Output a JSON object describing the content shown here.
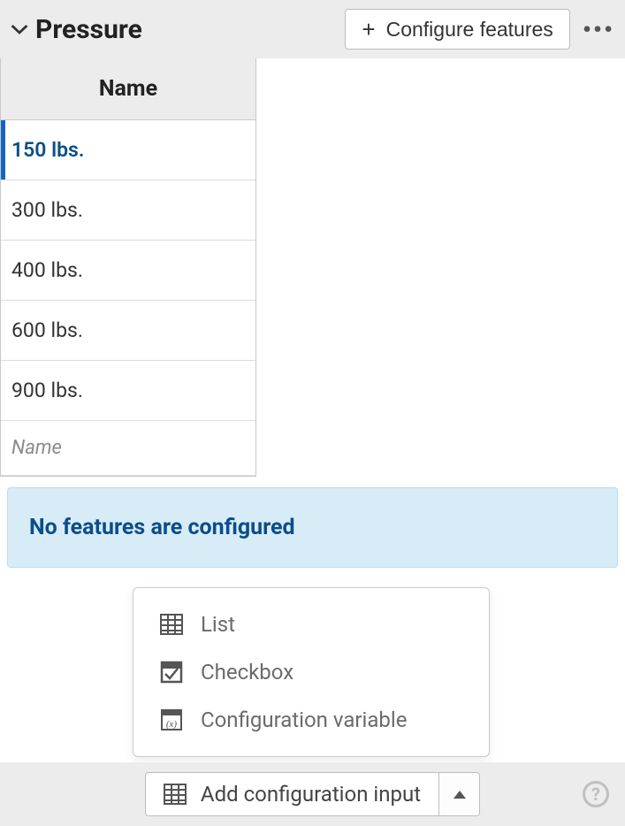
{
  "header": {
    "title": "Pressure",
    "configure_label": "Configure features"
  },
  "table": {
    "column_header": "Name",
    "rows": [
      {
        "label": "150 lbs.",
        "selected": true
      },
      {
        "label": "300 lbs.",
        "selected": false
      },
      {
        "label": "400 lbs.",
        "selected": false
      },
      {
        "label": "600 lbs.",
        "selected": false
      },
      {
        "label": "900 lbs.",
        "selected": false
      }
    ],
    "new_row_placeholder": "Name"
  },
  "banner": {
    "message": "No features are configured"
  },
  "popup": {
    "items": [
      {
        "label": "List",
        "icon": "table-icon"
      },
      {
        "label": "Checkbox",
        "icon": "checkbox-icon"
      },
      {
        "label": "Configuration variable",
        "icon": "variable-icon"
      }
    ]
  },
  "footer": {
    "add_label": "Add configuration input"
  }
}
